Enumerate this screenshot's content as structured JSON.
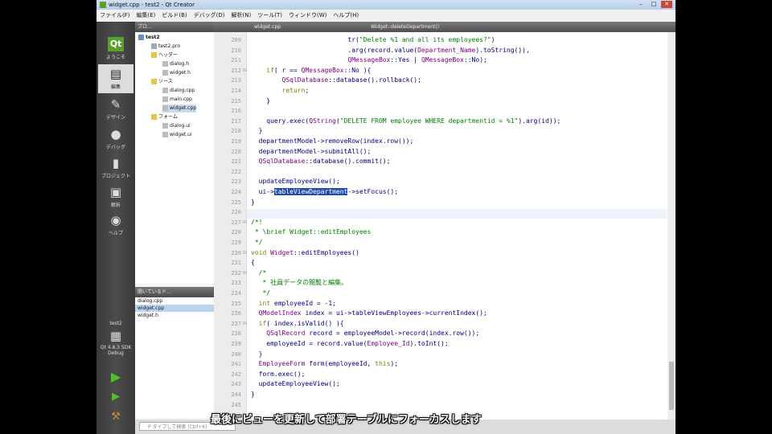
{
  "window": {
    "title": "widget.cpp - test2 - Qt Creator"
  },
  "menubar": [
    "ファイル(F)",
    "編集(E)",
    "ビルド(B)",
    "デバッグ(D)",
    "解析(N)",
    "ツール(T)",
    "ウィンドウ(W)",
    "ヘルプ(H)"
  ],
  "modes": [
    {
      "label": "ようこそ",
      "icon": "qt-welcome-icon"
    },
    {
      "label": "編集",
      "icon": "edit-icon"
    },
    {
      "label": "デザイン",
      "icon": "design-icon"
    },
    {
      "label": "デバッグ",
      "icon": "debug-icon"
    },
    {
      "label": "プロジェクト",
      "icon": "projects-icon"
    },
    {
      "label": "解析",
      "icon": "analyze-icon"
    },
    {
      "label": "ヘルプ",
      "icon": "help-icon"
    }
  ],
  "kit": {
    "project": "test2",
    "kit_name": "Qt 4.8.3 SDK",
    "config": "Debug"
  },
  "project_tree": {
    "header": "プロ…",
    "items": [
      {
        "label": "test2",
        "level": 0,
        "type": "project"
      },
      {
        "label": "test2.pro",
        "level": 1,
        "type": "file"
      },
      {
        "label": "ヘッダー",
        "level": 1,
        "type": "folder"
      },
      {
        "label": "dialog.h",
        "level": 2,
        "type": "file"
      },
      {
        "label": "widget.h",
        "level": 2,
        "type": "file"
      },
      {
        "label": "ソース",
        "level": 1,
        "type": "folder"
      },
      {
        "label": "dialog.cpp",
        "level": 2,
        "type": "file"
      },
      {
        "label": "main.cpp",
        "level": 2,
        "type": "file"
      },
      {
        "label": "widget.cpp",
        "level": 2,
        "type": "file",
        "selected": true
      },
      {
        "label": "フォーム",
        "level": 1,
        "type": "folder"
      },
      {
        "label": "dialog.ui",
        "level": 2,
        "type": "file"
      },
      {
        "label": "widget.ui",
        "level": 2,
        "type": "file"
      }
    ]
  },
  "open_documents": {
    "header": "開いているド…",
    "items": [
      {
        "label": "dialog.cpp",
        "selected": false
      },
      {
        "label": "widget.cpp",
        "selected": true
      },
      {
        "label": "widget.h",
        "selected": false
      }
    ]
  },
  "editor": {
    "file_tab": "widget.cpp",
    "function_tab": "Widget::deleteDepartment()",
    "lines": [
      {
        "n": "209",
        "html": "                         tr(<span class=\"str\">\"Delete %1 and all its employees?\"</span>)"
      },
      {
        "n": "210",
        "html": "                         .arg(record.value(<span class=\"cls\">Department_Name</span>).toString()),"
      },
      {
        "n": "211",
        "html": "                         <span class=\"cls\">QMessageBox</span>::Yes | <span class=\"cls\">QMessageBox</span>::No);"
      },
      {
        "n": "212",
        "html": "    <span class=\"kw\">if</span>( r == <span class=\"cls\">QMessageBox</span>::No ){"
      },
      {
        "n": "213",
        "html": "        <span class=\"cls\">QSqlDatabase</span>::database().rollback();"
      },
      {
        "n": "214",
        "html": "        <span class=\"kw\">return</span>;"
      },
      {
        "n": "215",
        "html": "    }"
      },
      {
        "n": "216",
        "html": ""
      },
      {
        "n": "217",
        "html": "    query.exec(<span class=\"cls\">QString</span>(<span class=\"str\">\"DELETE FROM employee WHERE departmentid = %1\"</span>).arg(id));"
      },
      {
        "n": "218",
        "html": "  }"
      },
      {
        "n": "219",
        "html": "  departmentModel->removeRow(index.row());"
      },
      {
        "n": "220",
        "html": "  departmentModel->submitAll();"
      },
      {
        "n": "221",
        "html": "  <span class=\"cls\">QSqlDatabase</span>::database().commit();"
      },
      {
        "n": "222",
        "html": ""
      },
      {
        "n": "223",
        "html": "  updateEmployeeView();"
      },
      {
        "n": "224",
        "html": "  ui-><span class=\"hl\">tableViewDepartment</span>->setFocus();"
      },
      {
        "n": "225",
        "html": "}"
      },
      {
        "n": "226",
        "html": ""
      },
      {
        "n": "227",
        "html": "<span class=\"cmt\">/*!</span>"
      },
      {
        "n": "228",
        "html": "<span class=\"cmt\"> * \\brief Widget::editEmployees</span>"
      },
      {
        "n": "229",
        "html": "<span class=\"cmt\"> */</span>"
      },
      {
        "n": "230",
        "html": "<span class=\"kw\">void</span> <span class=\"cls\">Widget</span>::editEmployees()"
      },
      {
        "n": "231",
        "html": "{"
      },
      {
        "n": "232",
        "html": "  <span class=\"cmt\">/*</span>"
      },
      {
        "n": "233",
        "html": "<span class=\"cmt\">   * 社員データの閲覧と編集。</span>"
      },
      {
        "n": "234",
        "html": "<span class=\"cmt\">   */</span>"
      },
      {
        "n": "235",
        "html": "  <span class=\"kw\">int</span> employeeId = -1;"
      },
      {
        "n": "236",
        "html": "  <span class=\"cls\">QModelIndex</span> index = ui->tableViewEmployees->currentIndex();"
      },
      {
        "n": "237",
        "html": "  <span class=\"kw\">if</span>( index.isValid() ){"
      },
      {
        "n": "238",
        "html": "    <span class=\"cls\">QSqlRecord</span> record = employeeModel->record(index.row());"
      },
      {
        "n": "239",
        "html": "    employeeId = record.value(<span class=\"cls\">Employee_Id</span>).toInt();"
      },
      {
        "n": "240",
        "html": "  }"
      },
      {
        "n": "241",
        "html": "  <span class=\"cls\">EmployeeForm</span> form(employeeId, <span class=\"kw\">this</span>);"
      },
      {
        "n": "242",
        "html": "  form.exec();"
      },
      {
        "n": "243",
        "html": "  updateEmployeeView();"
      },
      {
        "n": "244",
        "html": "}"
      },
      {
        "n": "245",
        "html": ""
      }
    ]
  },
  "locator": {
    "placeholder": "P  タイプして検索 (Ctrl+K)"
  },
  "subtitle": "最後にビューを更新して部署テーブルにフォーカスします"
}
